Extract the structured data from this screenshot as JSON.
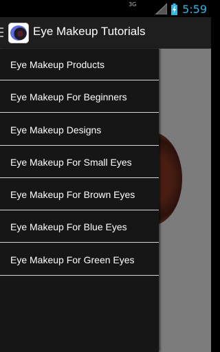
{
  "status_bar": {
    "network_label": "3G",
    "time": "5:59"
  },
  "action_bar": {
    "title": "Eye Makeup Tutorials"
  },
  "drawer": {
    "items": [
      {
        "label": "Eye Makeup Products"
      },
      {
        "label": "Eye Makeup For Beginners"
      },
      {
        "label": "Eye Makeup Designs"
      },
      {
        "label": "Eye Makeup For Small Eyes"
      },
      {
        "label": "Eye Makeup For Brown Eyes"
      },
      {
        "label": "Eye Makeup For Blue Eyes"
      },
      {
        "label": "Eye Makeup For Green Eyes"
      }
    ]
  },
  "colors": {
    "clock": "#33b5e5",
    "drawer_bg": "#161616",
    "content_bg": "#7c7c7c"
  }
}
